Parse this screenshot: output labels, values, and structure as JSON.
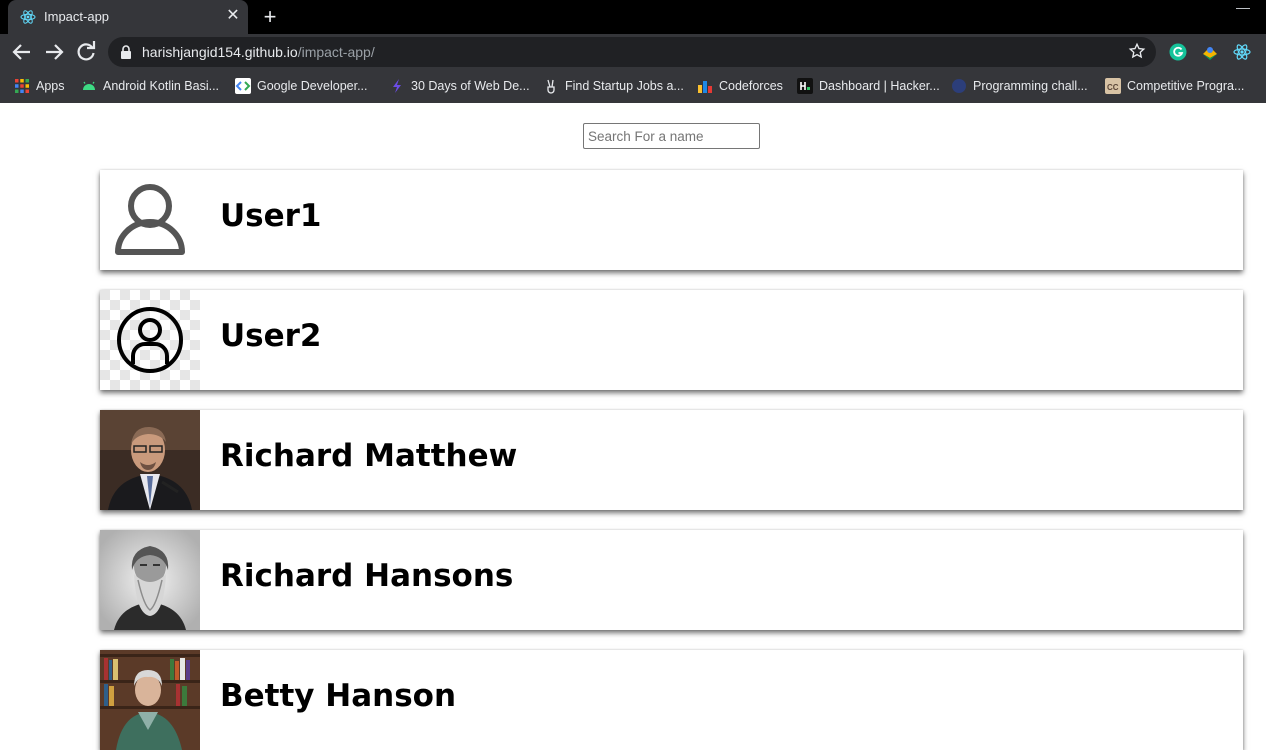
{
  "browser": {
    "tab": {
      "title": "Impact-app",
      "close_glyph": "✕",
      "favicon": "react-icon"
    },
    "new_tab_glyph": "+",
    "address": {
      "host": "harishjangid154.github.io",
      "path": "/impact-app/"
    },
    "bookmarks": [
      {
        "label": "Apps",
        "icon": "apps-grid-icon"
      },
      {
        "label": "Android Kotlin Basi...",
        "icon": "android-icon"
      },
      {
        "label": "Google Developer...",
        "icon": "google-developers-icon"
      },
      {
        "label": "30 Days of Web De...",
        "icon": "bolt-icon"
      },
      {
        "label": "Find Startup Jobs a...",
        "icon": "victory-hand-icon"
      },
      {
        "label": "Codeforces",
        "icon": "codeforces-icon"
      },
      {
        "label": "Dashboard | Hacker...",
        "icon": "hackerrank-icon"
      },
      {
        "label": "Programming chall...",
        "icon": "globe-icon"
      },
      {
        "label": "Competitive Progra...",
        "icon": "codechef-icon"
      }
    ]
  },
  "search": {
    "placeholder": "Search For a name",
    "value": ""
  },
  "users": [
    {
      "name": "User1",
      "avatar": "person-outline-icon"
    },
    {
      "name": "User2",
      "avatar": "person-circle-icon"
    },
    {
      "name": "Richard Matthew",
      "avatar": "photo"
    },
    {
      "name": "Richard Hansons",
      "avatar": "photo"
    },
    {
      "name": "Betty Hanson",
      "avatar": "photo"
    }
  ]
}
